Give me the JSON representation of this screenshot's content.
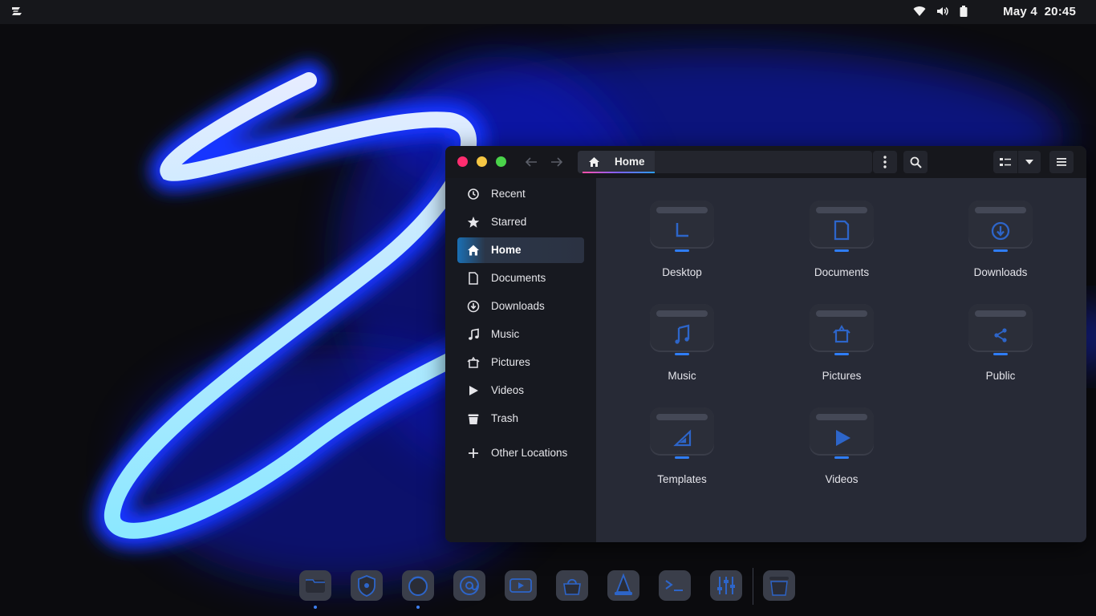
{
  "topbar": {
    "logo_icon": "zorin-logo-icon",
    "status_icons": [
      "wifi-icon",
      "volume-icon",
      "battery-icon"
    ],
    "date": "May 4",
    "time": "20:45"
  },
  "window": {
    "controls": {
      "close_color": "#ff2d6f",
      "minimize_color": "#f5c643",
      "maximize_color": "#4ad34a"
    },
    "path": {
      "current": "Home",
      "icon": "home-icon"
    },
    "accent": "#2a9df4"
  },
  "sidebar": {
    "items": [
      {
        "label": "Recent",
        "icon": "clock-icon"
      },
      {
        "label": "Starred",
        "icon": "star-icon"
      },
      {
        "label": "Home",
        "icon": "home-icon",
        "active": true
      },
      {
        "label": "Documents",
        "icon": "document-icon"
      },
      {
        "label": "Downloads",
        "icon": "download-icon"
      },
      {
        "label": "Music",
        "icon": "music-note-icon"
      },
      {
        "label": "Pictures",
        "icon": "picture-icon"
      },
      {
        "label": "Videos",
        "icon": "play-icon"
      },
      {
        "label": "Trash",
        "icon": "trash-icon"
      }
    ],
    "other_locations": {
      "label": "Other Locations",
      "icon": "plus-icon"
    }
  },
  "folders": [
    {
      "label": "Desktop",
      "glyph": "desktop-glyph"
    },
    {
      "label": "Documents",
      "glyph": "document-glyph"
    },
    {
      "label": "Downloads",
      "glyph": "download-glyph"
    },
    {
      "label": "Music",
      "glyph": "music-glyph"
    },
    {
      "label": "Pictures",
      "glyph": "picture-glyph"
    },
    {
      "label": "Public",
      "glyph": "share-glyph"
    },
    {
      "label": "Templates",
      "glyph": "template-glyph"
    },
    {
      "label": "Videos",
      "glyph": "video-glyph"
    }
  ],
  "dock": {
    "apps": [
      "files-app-icon",
      "security-app-icon",
      "firefox-app-icon",
      "mail-app-icon",
      "media-app-icon",
      "software-app-icon",
      "vlc-app-icon",
      "terminal-app-icon",
      "mixer-app-icon",
      "trash-app-icon"
    ]
  }
}
